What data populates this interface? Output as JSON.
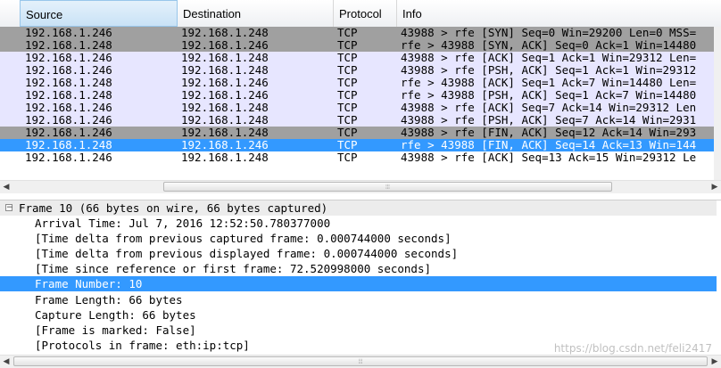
{
  "packet_list": {
    "columns": [
      "Source",
      "Destination",
      "Protocol",
      "Info"
    ],
    "rows": [
      {
        "source": "192.168.1.246",
        "destination": "192.168.1.248",
        "protocol": "TCP",
        "info": "43988 > rfe [SYN] Seq=0 Win=29200 Len=0 MSS=",
        "style": "syn"
      },
      {
        "source": "192.168.1.248",
        "destination": "192.168.1.246",
        "protocol": "TCP",
        "info": "rfe > 43988 [SYN, ACK] Seq=0 Ack=1 Win=14480",
        "style": "syn"
      },
      {
        "source": "192.168.1.246",
        "destination": "192.168.1.248",
        "protocol": "TCP",
        "info": "43988 > rfe [ACK] Seq=1 Ack=1 Win=29312 Len=",
        "style": "norm"
      },
      {
        "source": "192.168.1.246",
        "destination": "192.168.1.248",
        "protocol": "TCP",
        "info": "43988 > rfe [PSH, ACK] Seq=1 Ack=1 Win=29312",
        "style": "norm"
      },
      {
        "source": "192.168.1.248",
        "destination": "192.168.1.246",
        "protocol": "TCP",
        "info": "rfe > 43988 [ACK] Seq=1 Ack=7 Win=14480 Len=",
        "style": "norm"
      },
      {
        "source": "192.168.1.248",
        "destination": "192.168.1.246",
        "protocol": "TCP",
        "info": "rfe > 43988 [PSH, ACK] Seq=1 Ack=7 Win=14480",
        "style": "norm"
      },
      {
        "source": "192.168.1.246",
        "destination": "192.168.1.248",
        "protocol": "TCP",
        "info": "43988 > rfe [ACK] Seq=7 Ack=14 Win=29312 Len",
        "style": "norm"
      },
      {
        "source": "192.168.1.246",
        "destination": "192.168.1.248",
        "protocol": "TCP",
        "info": "43988 > rfe [PSH, ACK] Seq=7 Ack=14 Win=2931",
        "style": "norm"
      },
      {
        "source": "192.168.1.246",
        "destination": "192.168.1.248",
        "protocol": "TCP",
        "info": "43988 > rfe [FIN, ACK] Seq=12 Ack=14 Win=293",
        "style": "fin"
      },
      {
        "source": "192.168.1.248",
        "destination": "192.168.1.246",
        "protocol": "TCP",
        "info": "rfe > 43988 [FIN, ACK] Seq=14 Ack=13 Win=144",
        "style": "selected"
      },
      {
        "source": "192.168.1.246",
        "destination": "192.168.1.248",
        "protocol": "TCP",
        "info": "43988 > rfe [ACK] Seq=13 Ack=15 Win=29312 Le",
        "style": "last"
      }
    ]
  },
  "details": {
    "frame_summary": "Frame 10 (66 bytes on wire, 66 bytes captured)",
    "expander_symbol": "−",
    "lines": [
      "Arrival Time: Jul  7, 2016 12:52:50.780377000",
      "[Time delta from previous captured frame: 0.000744000 seconds]",
      "[Time delta from previous displayed frame: 0.000744000 seconds]",
      "[Time since reference or first frame: 72.520998000 seconds]",
      "Frame Number: 10",
      "Frame Length: 66 bytes",
      "Capture Length: 66 bytes",
      "[Frame is marked: False]",
      "[Protocols in frame: eth:ip:tcp]"
    ],
    "selected_line": "Frame Number: 10"
  },
  "watermark": "https://blog.csdn.net/feli2417"
}
